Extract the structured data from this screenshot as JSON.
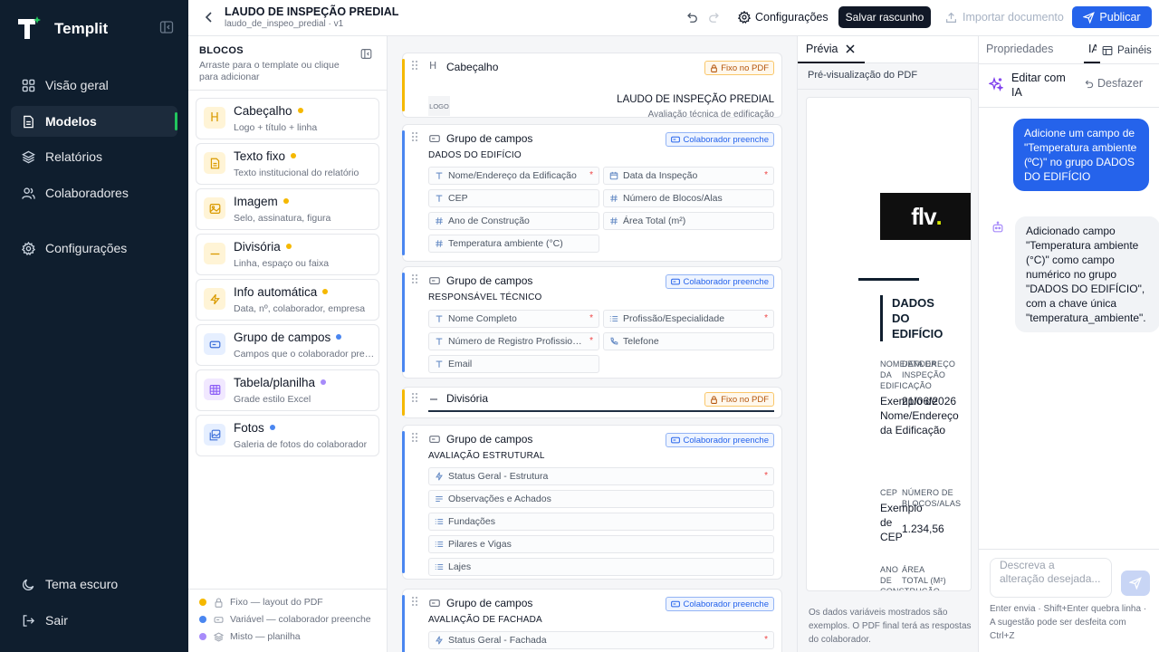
{
  "app": {
    "name": "Templit"
  },
  "nav": {
    "items": [
      {
        "label": "Visão geral"
      },
      {
        "label": "Modelos"
      },
      {
        "label": "Relatórios"
      },
      {
        "label": "Colaboradores"
      },
      {
        "label": "Configurações"
      }
    ],
    "bottom": [
      {
        "label": "Tema escuro"
      },
      {
        "label": "Sair"
      }
    ]
  },
  "topbar": {
    "title": "LAUDO DE INSPEÇÃO PREDIAL",
    "subtitle": "laudo_de_inspeo_predial · v1",
    "settings_label": "Configurações",
    "save_label": "Salvar rascunho",
    "import_label": "Importar documento",
    "publish_label": "Publicar"
  },
  "blocks": {
    "heading": "BLOCOS",
    "description": "Arraste para o template ou clique para adicionar",
    "items": [
      {
        "title": "Cabeçalho",
        "desc": "Logo + título + linha",
        "icon": "heading-icon",
        "tint": "#fff4d6",
        "icon_color": "#d99a00",
        "dot": "#f5b800"
      },
      {
        "title": "Texto fixo",
        "desc": "Texto institucional do relatório",
        "icon": "document-icon",
        "tint": "#fff4d6",
        "icon_color": "#d99a00",
        "dot": "#f5b800"
      },
      {
        "title": "Imagem",
        "desc": "Selo, assinatura, figura",
        "icon": "image-icon",
        "tint": "#fff4d6",
        "icon_color": "#d99a00",
        "dot": "#f5b800"
      },
      {
        "title": "Divisória",
        "desc": "Linha, espaço ou faixa",
        "icon": "minus-icon",
        "tint": "#fff4d6",
        "icon_color": "#d99a00",
        "dot": "#f5b800"
      },
      {
        "title": "Info automática",
        "desc": "Data, nº, colaborador, empresa",
        "icon": "bolt-icon",
        "tint": "#fff4d6",
        "icon_color": "#d99a00",
        "dot": "#f5b800"
      },
      {
        "title": "Grupo de campos",
        "desc": "Campos que o colaborador preenche",
        "icon": "input-icon",
        "tint": "#e6efff",
        "icon_color": "#3b6fd9",
        "dot": "#4a86f0"
      },
      {
        "title": "Tabela/planilha",
        "desc": "Grade estilo Excel",
        "icon": "table-icon",
        "tint": "#f1e8ff",
        "icon_color": "#8b5cf6",
        "dot": "#a78bfa"
      },
      {
        "title": "Fotos",
        "desc": "Galeria de fotos do colaborador",
        "icon": "photos-icon",
        "tint": "#e6efff",
        "icon_color": "#3b6fd9",
        "dot": "#4a86f0"
      }
    ],
    "legend": [
      {
        "label": "Fixo — layout do PDF",
        "color": "#f5b800"
      },
      {
        "label": "Variável — colaborador preenche",
        "color": "#4a86f0"
      },
      {
        "label": "Misto — planilha",
        "color": "#a78bfa"
      }
    ]
  },
  "canvas": {
    "header_card": {
      "title": "Cabeçalho",
      "badge": "Fixo no PDF",
      "logo_text": "LOGO",
      "doc_title": "LAUDO DE INSPEÇÃO PREDIAL",
      "doc_subtitle": "Avaliação técnica de edificação"
    },
    "groups": [
      {
        "title": "Grupo de campos",
        "badge": "Colaborador preenche",
        "name": "DADOS DO EDIFÍCIO",
        "fields": [
          {
            "label": "Nome/Endereço da Edificação",
            "icon": "text-icon",
            "req": "*"
          },
          {
            "label": "Data da Inspeção",
            "icon": "calendar-icon",
            "req": "*"
          },
          {
            "label": "CEP",
            "icon": "text-icon",
            "req": ""
          },
          {
            "label": "Número de Blocos/Alas",
            "icon": "hash-icon",
            "req": ""
          },
          {
            "label": "Ano de Construção",
            "icon": "hash-icon",
            "req": ""
          },
          {
            "label": "Área Total (m²)",
            "icon": "hash-icon",
            "req": ""
          },
          {
            "label": "Temperatura ambiente (°C)",
            "icon": "hash-icon",
            "req": ""
          }
        ]
      },
      {
        "title": "Grupo de campos",
        "badge": "Colaborador preenche",
        "name": "RESPONSÁVEL TÉCNICO",
        "fields": [
          {
            "label": "Nome Completo",
            "icon": "text-icon",
            "req": "*"
          },
          {
            "label": "Profissão/Especialidade",
            "icon": "list-icon",
            "req": "*"
          },
          {
            "label": "Número de Registro Profissional (CREA/CAU)",
            "icon": "text-icon",
            "req": "*"
          },
          {
            "label": "Telefone",
            "icon": "phone-icon",
            "req": ""
          },
          {
            "label": "Email",
            "icon": "text-icon",
            "req": ""
          }
        ]
      }
    ],
    "divider_card": {
      "title": "Divisória",
      "badge": "Fixo no PDF"
    },
    "groups2": [
      {
        "title": "Grupo de campos",
        "badge": "Colaborador preenche",
        "name": "AVALIAÇÃO ESTRUTURAL",
        "fields": [
          {
            "label": "Status Geral - Estrutura",
            "icon": "status-icon",
            "req": "*"
          },
          {
            "label": "Observações e Achados",
            "icon": "paragraph-icon",
            "req": ""
          },
          {
            "label": "Fundações",
            "icon": "list-icon",
            "req": ""
          },
          {
            "label": "Pilares e Vigas",
            "icon": "list-icon",
            "req": ""
          },
          {
            "label": "Lajes",
            "icon": "list-icon",
            "req": ""
          }
        ]
      },
      {
        "title": "Grupo de campos",
        "badge": "Colaborador preenche",
        "name": "AVALIAÇÃO DE FACHADA",
        "fields": [
          {
            "label": "Status Geral - Fachada",
            "icon": "status-icon",
            "req": "*"
          }
        ]
      }
    ]
  },
  "preview": {
    "tab_label": "Prévia",
    "title": "Pré-visualização do PDF",
    "logo_text": "flv",
    "logo_dot": ".",
    "section": "DADOS DO EDIFÍCIO",
    "labels": {
      "nome": "NOME/ENDEREÇO DA EDIFICAÇÃO",
      "data": "DATA DA INSPEÇÃO",
      "cep": "CEP",
      "blocos": "NÚMERO DE BLOCOS/ALAS",
      "ano": "ANO DE CONSTRUÇÃO",
      "area": "ÁREA TOTAL (M²)"
    },
    "values": {
      "nome": "Exemplo de Nome/Endereço da Edificação",
      "data": "21/06/2026",
      "cep": "Exemplo de CEP",
      "blocos": "1.234,56"
    },
    "footer": "Os dados variáveis mostrados são exemplos. O PDF final terá as respostas do colaborador."
  },
  "right": {
    "tab_properties": "Propriedades",
    "tab_ia": "IA",
    "panels_label": "Painéis",
    "edit_ai_label": "Editar com IA",
    "undo_label": "Desfazer",
    "user_message": "Adicione um campo de \"Temperatura ambiente (ºC)\" no grupo DADOS DO EDIFÍCIO",
    "ai_message": "Adicionado campo \"Temperatura ambiente (°C)\" como campo numérico no grupo \"DADOS DO EDIFÍCIO\", com a chave única \"temperatura_ambiente\".",
    "input_placeholder": "Descreva a alteração desejada...",
    "hint": "Enter envia · Shift+Enter quebra linha · A sugestão pode ser desfeita com Ctrl+Z"
  }
}
